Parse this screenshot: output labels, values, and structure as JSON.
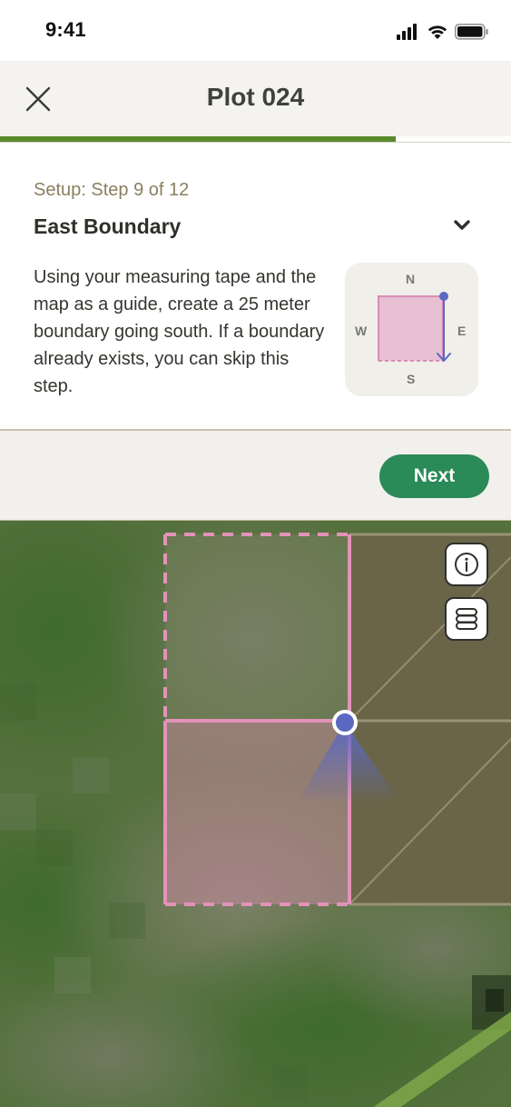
{
  "status_bar": {
    "time": "9:41",
    "icons": [
      "signal-icon",
      "wifi-icon",
      "battery-icon"
    ]
  },
  "header": {
    "title": "Plot 024",
    "close_icon": "close-icon"
  },
  "progress": {
    "current_step": 9,
    "total_steps": 12,
    "fraction": 0.775,
    "color": "#5b8a2d"
  },
  "step": {
    "label": "Setup: Step 9 of 12",
    "title": "East Boundary",
    "toggle_icon": "chevron-down-icon",
    "body": "Using your measuring tape and the map as a guide, create a 25 meter boundary going south. If a boundary already exists, you can skip this step."
  },
  "compass": {
    "north": "N",
    "east": "E",
    "south": "S",
    "west": "W"
  },
  "actions": {
    "next_label": "Next",
    "next_color": "#2a8a58"
  },
  "map": {
    "info_icon": "info-icon",
    "layers_icon": "layers-icon",
    "boundary_color": "#e392b9",
    "location_color": "#5b68c4"
  }
}
